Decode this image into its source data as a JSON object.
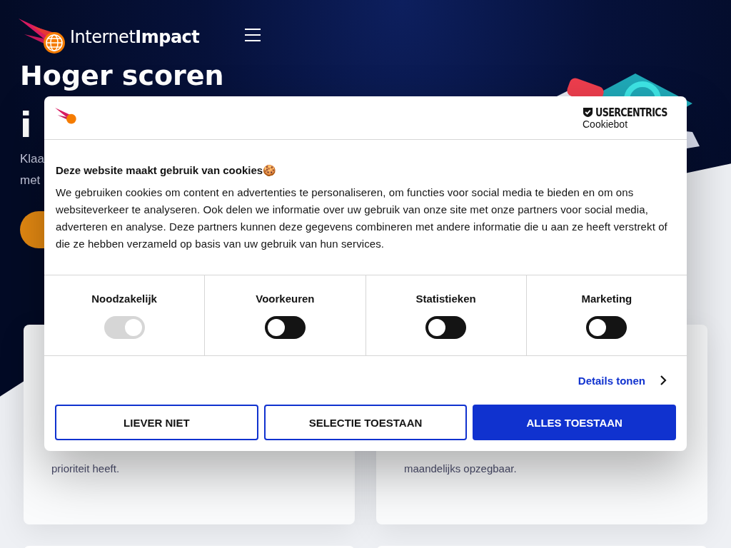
{
  "header": {
    "logo": "Internet**Impact**"
  },
  "hero": {
    "heading": "Hoger scoren",
    "heading_cut": "i",
    "subtitle_lines": [
      "Klaa",
      "met"
    ]
  },
  "cards": [
    {
      "text": "prioriteit heeft."
    },
    {
      "text": "maandelijks opzegbaar."
    }
  ],
  "consent": {
    "brand": "USERCENTRICS",
    "product": "Cookiebot",
    "title": "Deze website maakt gebruik van cookies🍪",
    "body": "We gebruiken cookies om content en advertenties te personaliseren, om functies voor social media te bieden en om ons websiteverkeer te analyseren. Ook delen we informatie over uw gebruik van onze site met onze partners voor social media, adverteren en analyse. Deze partners kunnen deze gegevens combineren met andere informatie die u aan ze heeft verstrekt of die ze hebben verzameld op basis van uw gebruik van hun services.",
    "categories": [
      {
        "label": "Noodzakelijk",
        "on": true,
        "disabled": true
      },
      {
        "label": "Voorkeuren",
        "on": false,
        "disabled": false
      },
      {
        "label": "Statistieken",
        "on": false,
        "disabled": false
      },
      {
        "label": "Marketing",
        "on": false,
        "disabled": false
      }
    ],
    "details_link": "Details tonen",
    "buttons": [
      {
        "label": "LIEVER NIET",
        "kind": "outline"
      },
      {
        "label": "SELECTIE TOESTAAN",
        "kind": "outline"
      },
      {
        "label": "ALLES TOESTAAN",
        "kind": "primary"
      }
    ]
  }
}
